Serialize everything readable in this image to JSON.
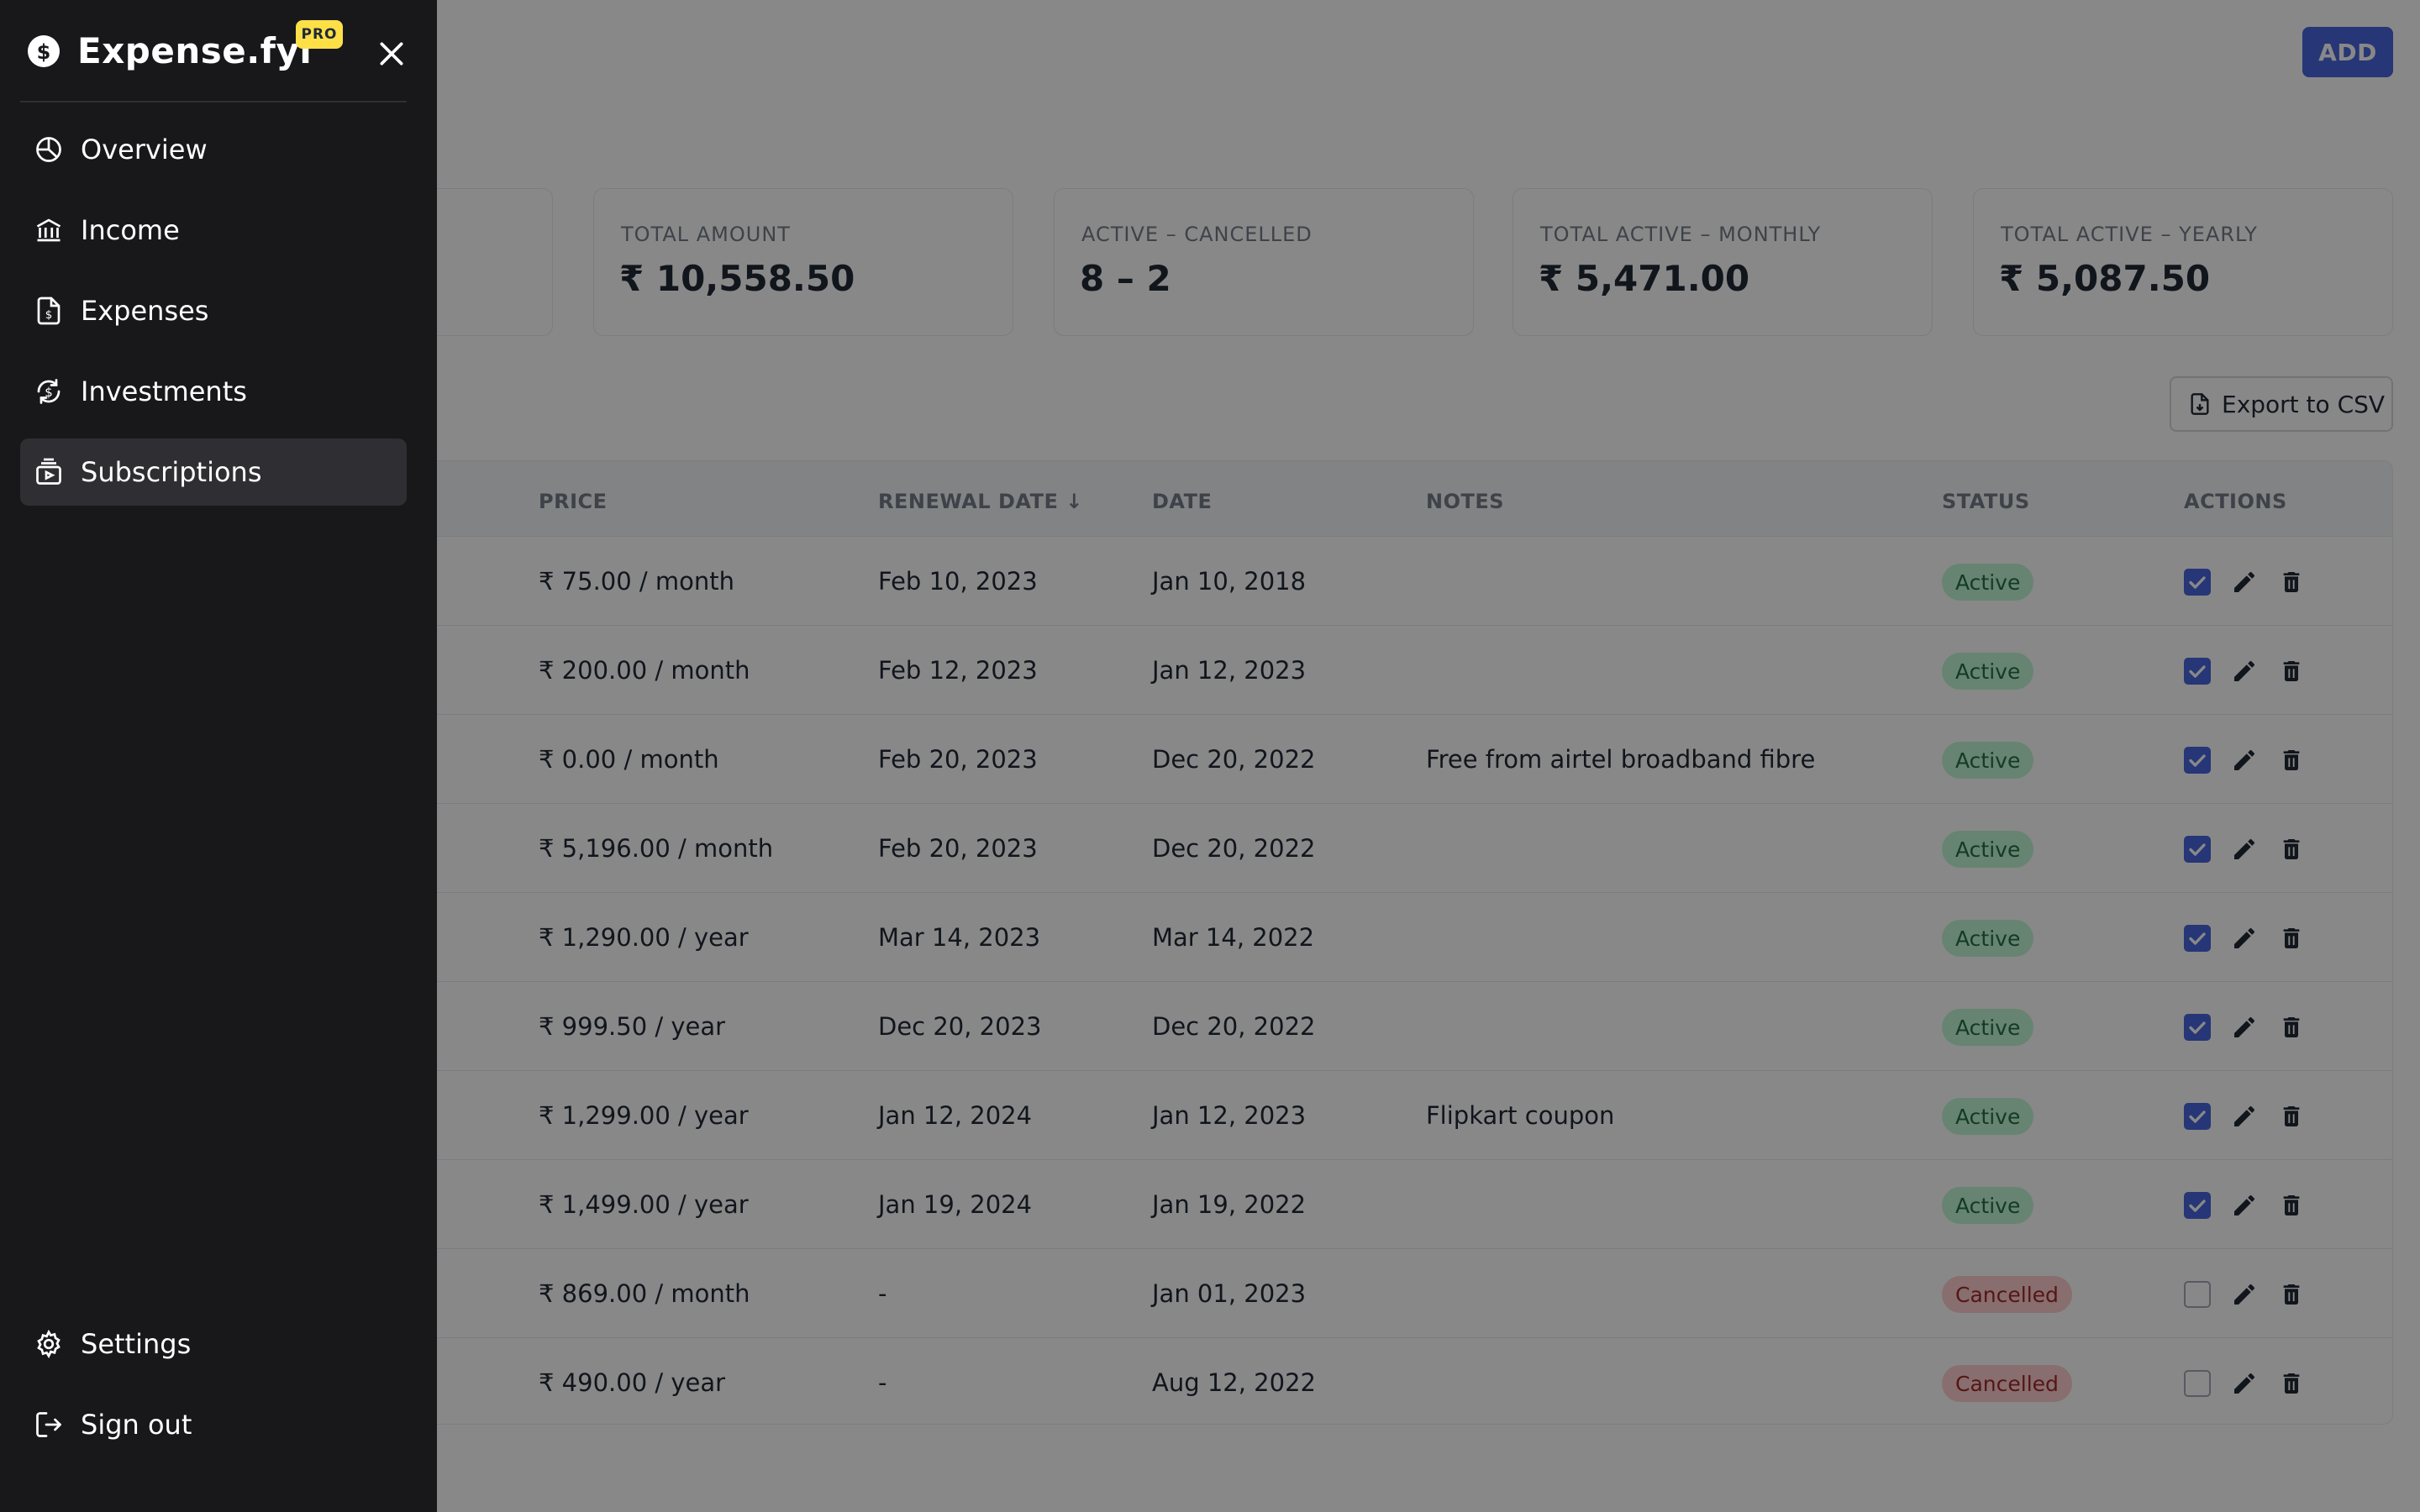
{
  "app": {
    "name": "Expense.fyi",
    "badge": "PRO"
  },
  "sidebar": {
    "items": [
      {
        "label": "Overview",
        "icon": "pie-chart-icon",
        "active": false
      },
      {
        "label": "Income",
        "icon": "bank-icon",
        "active": false
      },
      {
        "label": "Expenses",
        "icon": "receipt-icon",
        "active": false
      },
      {
        "label": "Investments",
        "icon": "investment-icon",
        "active": false
      },
      {
        "label": "Subscriptions",
        "icon": "subscription-icon",
        "active": true
      }
    ],
    "bottom_items": [
      {
        "label": "Settings",
        "icon": "gear-icon"
      },
      {
        "label": "Sign out",
        "icon": "sign-out-icon"
      }
    ]
  },
  "header": {
    "add_label": "ADD"
  },
  "stats": [
    {
      "label": "TOTAL AMOUNT",
      "value": "₹ 10,558.50"
    },
    {
      "label": "ACTIVE – CANCELLED",
      "value": "8 – 2"
    },
    {
      "label": "TOTAL ACTIVE – MONTHLY",
      "value": "₹ 5,471.00"
    },
    {
      "label": "TOTAL ACTIVE – YEARLY",
      "value": "₹ 5,087.50"
    }
  ],
  "export": {
    "label": "Export to CSV"
  },
  "table": {
    "columns": {
      "price": "PRICE",
      "renewal_date": "RENEWAL DATE ↓",
      "date": "DATE",
      "notes": "NOTES",
      "status": "STATUS",
      "actions": "ACTIONS"
    },
    "rows": [
      {
        "price": "₹ 75.00 / month",
        "renewal": "Feb 10, 2023",
        "date": "Jan 10, 2018",
        "notes": "",
        "status": "Active",
        "checked": true
      },
      {
        "price": "₹ 200.00 / month",
        "renewal": "Feb 12, 2023",
        "date": "Jan 12, 2023",
        "notes": "",
        "status": "Active",
        "checked": true
      },
      {
        "price": "₹ 0.00 / month",
        "renewal": "Feb 20, 2023",
        "date": "Dec 20, 2022",
        "notes": "Free from airtel broadband fibre",
        "status": "Active",
        "checked": true
      },
      {
        "price": "₹ 5,196.00 / month",
        "renewal": "Feb 20, 2023",
        "date": "Dec 20, 2022",
        "notes": "",
        "status": "Active",
        "checked": true
      },
      {
        "price": "₹ 1,290.00 / year",
        "renewal": "Mar 14, 2023",
        "date": "Mar 14, 2022",
        "notes": "",
        "status": "Active",
        "checked": true
      },
      {
        "price": "₹ 999.50 / year",
        "renewal": "Dec 20, 2023",
        "date": "Dec 20, 2022",
        "notes": "",
        "status": "Active",
        "checked": true
      },
      {
        "price": "₹ 1,299.00 / year",
        "renewal": "Jan 12, 2024",
        "date": "Jan 12, 2023",
        "notes": "Flipkart coupon",
        "status": "Active",
        "checked": true
      },
      {
        "price": "₹ 1,499.00 / year",
        "renewal": "Jan 19, 2024",
        "date": "Jan 19, 2022",
        "notes": "",
        "status": "Active",
        "checked": true
      },
      {
        "price": "₹ 869.00 / month",
        "renewal": "-",
        "date": "Jan 01, 2023",
        "notes": "",
        "status": "Cancelled",
        "checked": false
      },
      {
        "price": "₹ 490.00 / year",
        "renewal": "-",
        "date": "Aug 12, 2022",
        "notes": "",
        "status": "Cancelled",
        "checked": false
      }
    ]
  },
  "colors": {
    "accent": "#3b5bdb",
    "sidebar_bg": "#18181b",
    "active_badge": "#bbf7d0",
    "cancelled_badge": "#fecaca",
    "pro_badge": "#fde047"
  }
}
